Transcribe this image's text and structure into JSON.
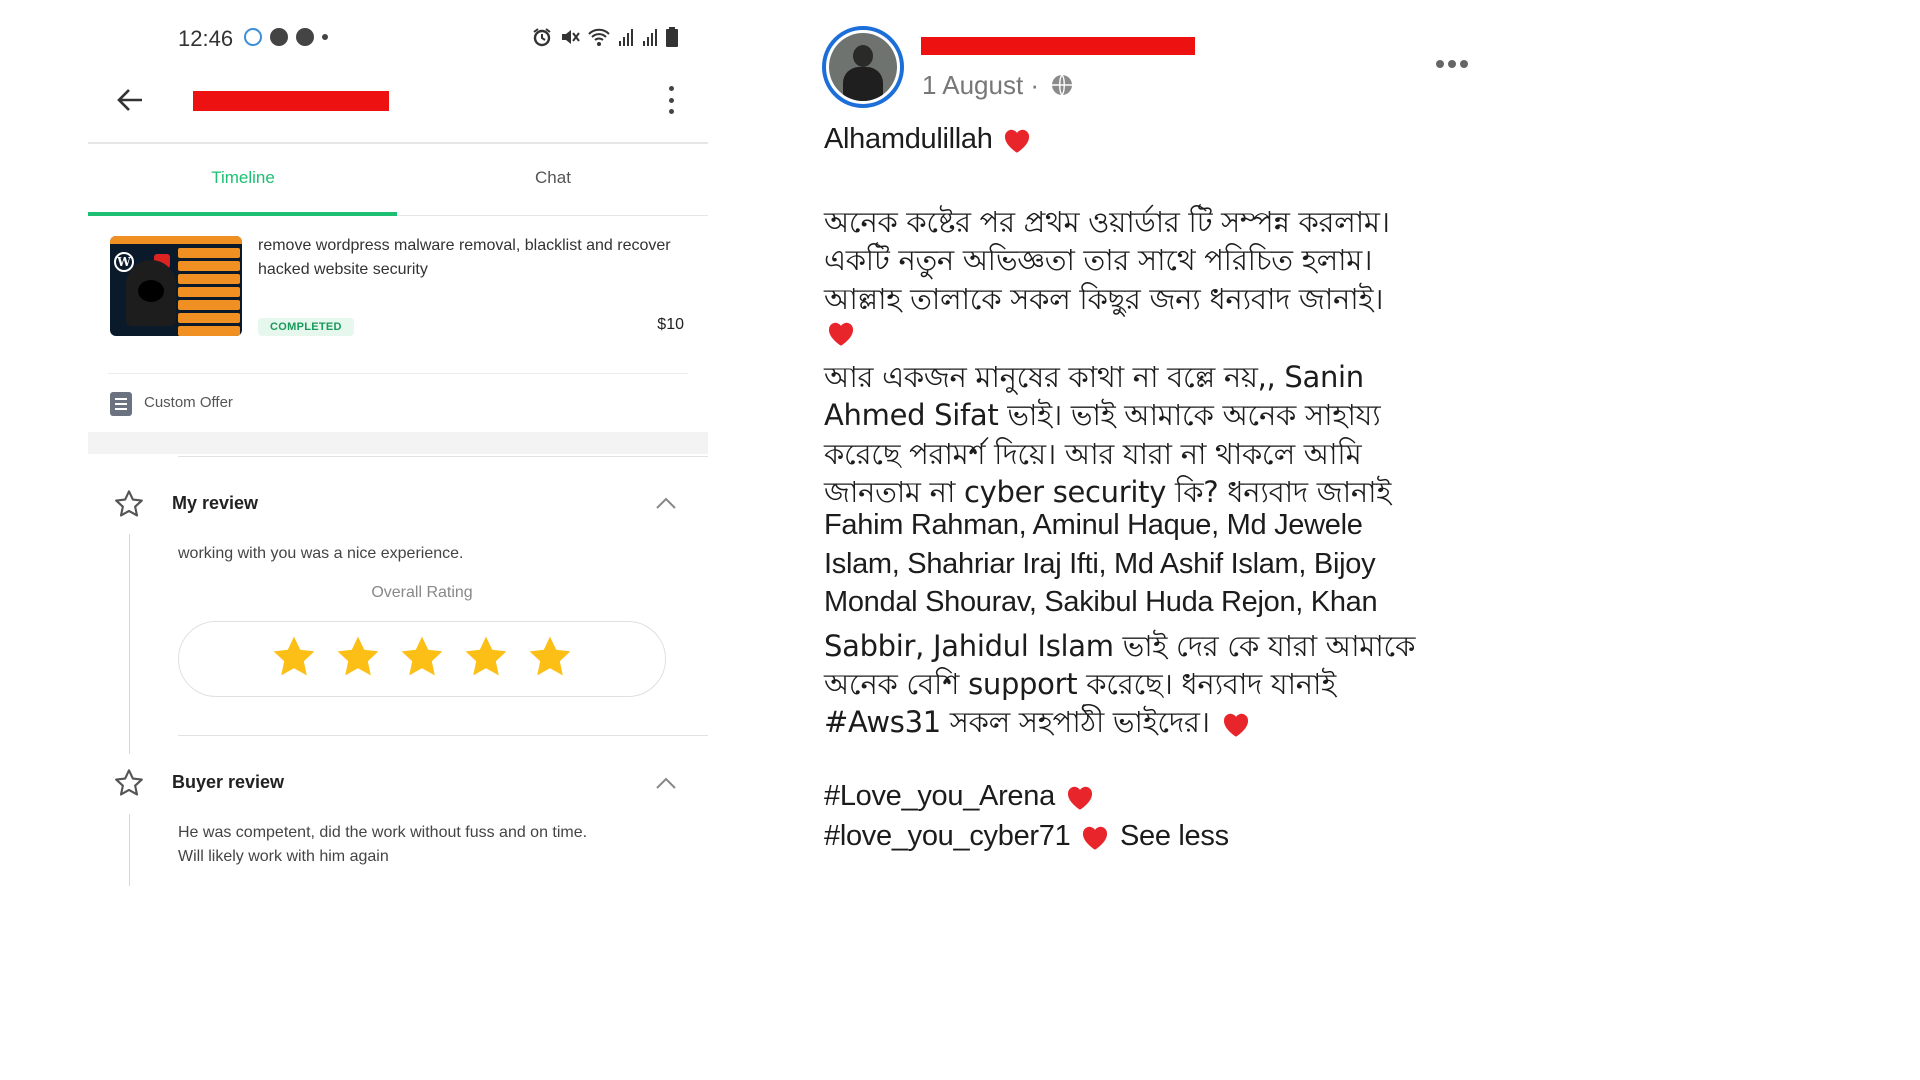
{
  "status_bar": {
    "time": "12:46"
  },
  "app": {
    "tabs": [
      {
        "label": "Timeline",
        "active": true
      },
      {
        "label": "Chat",
        "active": false
      }
    ],
    "accent_color": "#1dbf73",
    "order": {
      "title": "remove wordpress malware removal, blacklist and recover hacked  website security",
      "status": "COMPLETED",
      "price": "$10"
    },
    "custom_offer_label": "Custom Offer",
    "my_review": {
      "title": "My review",
      "text": "working with you was a nice experience.",
      "rating_label": "Overall Rating",
      "rating": 5,
      "rating_max": 5
    },
    "buyer_review": {
      "title": "Buyer review",
      "text_line1": "He was competent, did the work without fuss and on time.",
      "text_line2": "Will likely work with him again"
    }
  },
  "post": {
    "date": "1 August · ",
    "lines": [
      "Alhamdulillah",
      "অনেক কষ্টের পর প্রথম ওয়ার্ডার টি সম্পন্ন করলাম।",
      "একটি নতুন অভিজ্ঞতা তার সাথে পরিচিত হলাম।",
      "আল্লাহ তালাকে সকল কিছুর জন্য ধন্যবাদ জানাই।",
      "আর একজন মানুষের কাথা না বল্লে নয়,, Sanin",
      "Ahmed Sifat ভাই। ভাই আমাকে অনেক সাহায্য",
      "করেছে পরামর্শ দিয়ে। আর যারা না থাকলে আমি",
      "জানতাম না cyber security কি? ধন্যবাদ জানাই",
      "Fahim Rahman, Aminul Haque, Md Jewele",
      "Islam, Shahriar Iraj Ifti, Md Ashif Islam, Bijoy",
      "Mondal Shourav, Sakibul Huda Rejon, Khan",
      "Sabbir, Jahidul Islam ভাই দের কে যারা আমাকে",
      "অনেক বেশি support করেছে। ধন্যবাদ যানাই",
      "#Aws31 সকল সহপাঠী ভাইদের।",
      "#Love_you_Arena",
      "#love_you_cyber71"
    ],
    "see_less": "See less",
    "heart_color": "#e8252b"
  }
}
